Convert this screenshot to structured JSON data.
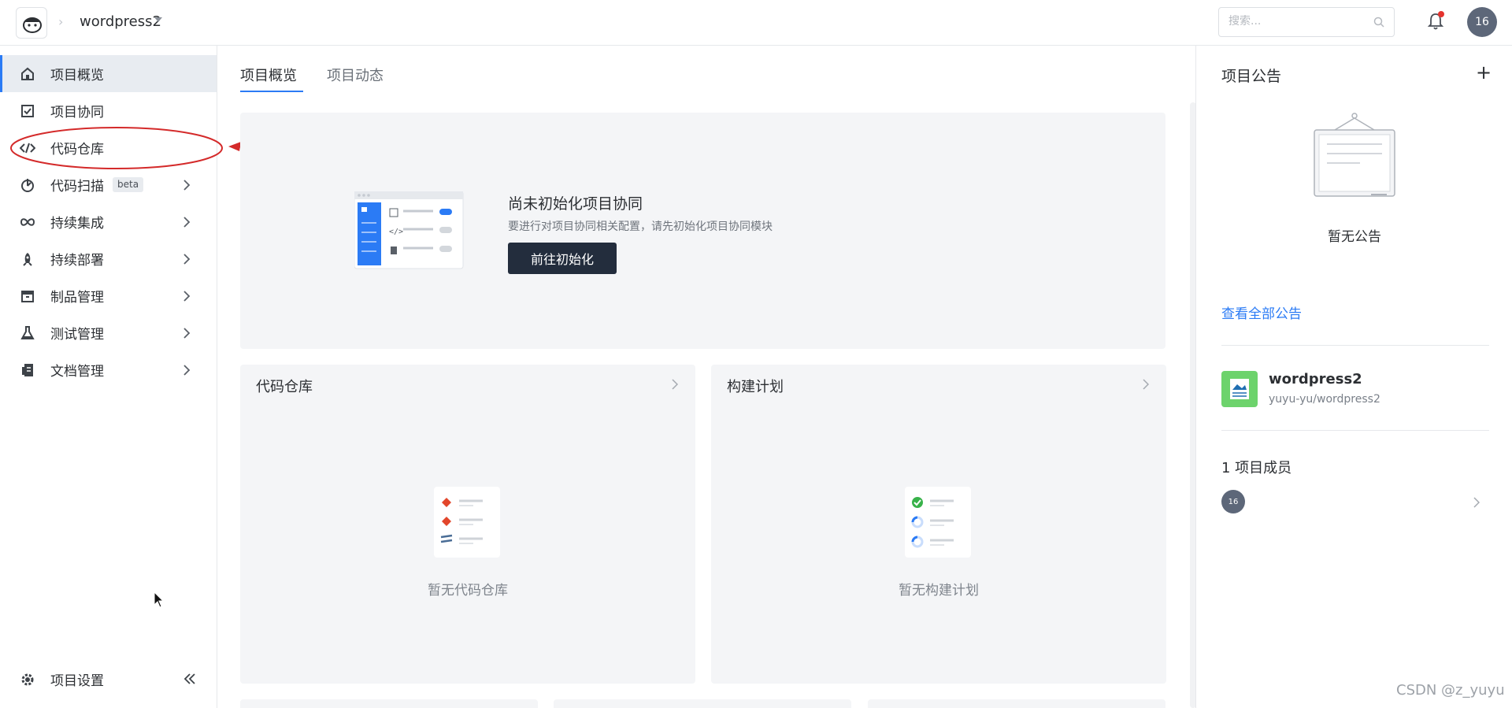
{
  "header": {
    "project_name": "wordpress2",
    "breadcrumb_sep": "›",
    "search_placeholder": "搜索...",
    "avatar_text": "16"
  },
  "sidebar": {
    "items": [
      {
        "label": "项目概览",
        "icon": "home-icon",
        "active": true,
        "expandable": false
      },
      {
        "label": "项目协同",
        "icon": "checkbox-icon",
        "active": false,
        "expandable": false
      },
      {
        "label": "代码仓库",
        "icon": "code-icon",
        "active": false,
        "expandable": false
      },
      {
        "label": "代码扫描",
        "icon": "scan-icon",
        "active": false,
        "expandable": true,
        "badge": "beta"
      },
      {
        "label": "持续集成",
        "icon": "infinity-icon",
        "active": false,
        "expandable": true
      },
      {
        "label": "持续部署",
        "icon": "rocket-icon",
        "active": false,
        "expandable": true
      },
      {
        "label": "制品管理",
        "icon": "box-icon",
        "active": false,
        "expandable": true
      },
      {
        "label": "测试管理",
        "icon": "flask-icon",
        "active": false,
        "expandable": true
      },
      {
        "label": "文档管理",
        "icon": "document-icon",
        "active": false,
        "expandable": true
      }
    ],
    "settings_label": "项目设置",
    "collapse_glyph": "«"
  },
  "tabs": [
    {
      "label": "项目概览",
      "active": true
    },
    {
      "label": "项目动态",
      "active": false
    }
  ],
  "init_panel": {
    "title": "尚未初始化项目协同",
    "subtitle": "要进行对项目协同相关配置，请先初始化项目协同模块",
    "button": "前往初始化"
  },
  "cards": [
    {
      "title": "代码仓库",
      "empty_text": "暂无代码仓库"
    },
    {
      "title": "构建计划",
      "empty_text": "暂无构建计划"
    }
  ],
  "right_panel": {
    "title": "项目公告",
    "add_glyph": "+",
    "empty_text": "暂无公告",
    "view_all": "查看全部公告",
    "repo_name": "wordpress2",
    "repo_path": "yuyu-yu/wordpress2",
    "members_title": "1 项目成员",
    "member_avatar": "16"
  },
  "colors": {
    "accent": "#2b7bf5",
    "button_dark": "#232d3d",
    "annotation_red": "#d42a2a",
    "repo_green": "#6dd36c"
  },
  "watermark": "CSDN @z_yuyu"
}
